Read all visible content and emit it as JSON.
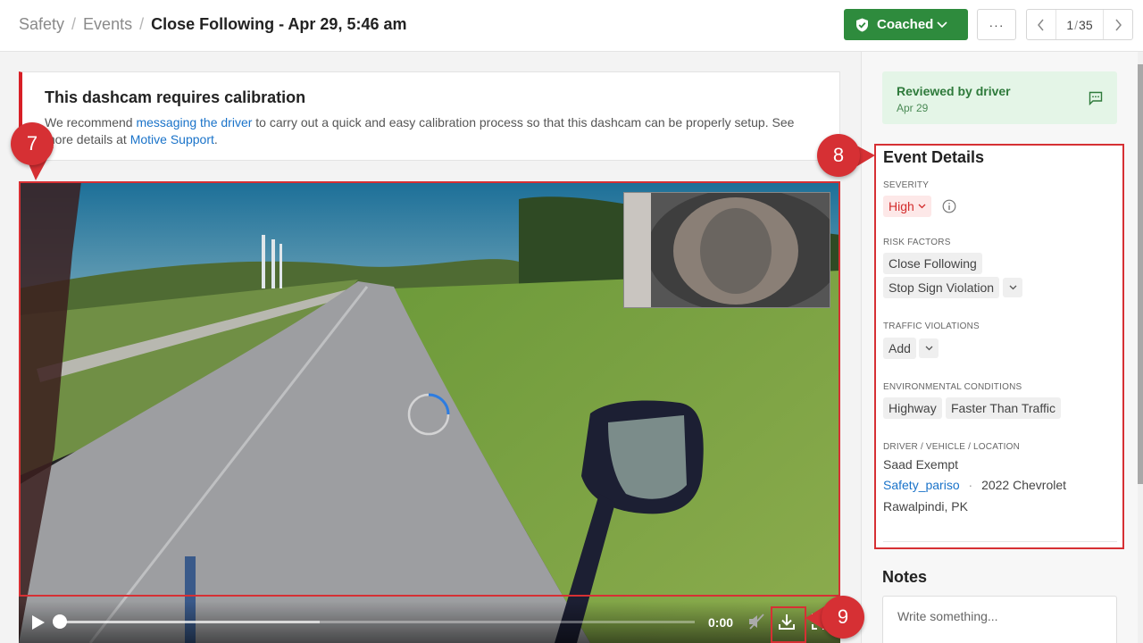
{
  "header": {
    "breadcrumb": [
      "Safety",
      "Events"
    ],
    "title": "Close Following - Apr 29, 5:46 am",
    "coached_label": "Coached",
    "more_label": "···",
    "pager": {
      "current": "1",
      "separator": "/",
      "total": "35"
    }
  },
  "banner": {
    "title": "This dashcam requires calibration",
    "text_before": "We recommend ",
    "link1": "messaging the driver",
    "text_middle": " to carry out a quick and easy calibration process so that this dashcam can be properly setup. See more details at ",
    "link2": "Motive Support",
    "text_after": "."
  },
  "video": {
    "time": "0:00",
    "progress_fraction": 0,
    "buffered_fraction": 0.41
  },
  "annotations": [
    "7",
    "8",
    "9"
  ],
  "sidebar": {
    "reviewed": {
      "title": "Reviewed by driver",
      "date": "Apr 29"
    },
    "details_title": "Event Details",
    "severity": {
      "label": "SEVERITY",
      "value": "High"
    },
    "risk_factors": {
      "label": "RISK FACTORS",
      "items": [
        "Close Following",
        "Stop Sign Violation"
      ]
    },
    "traffic_violations": {
      "label": "TRAFFIC VIOLATIONS",
      "add_label": "Add"
    },
    "environmental_conditions": {
      "label": "ENVIRONMENTAL CONDITIONS",
      "items": [
        "Highway",
        "Faster Than Traffic"
      ]
    },
    "driver_vehicle_location": {
      "label": "DRIVER / VEHICLE / LOCATION",
      "driver": "Saad Exempt",
      "vehicle_id": "Safety_pariso",
      "dot": "·",
      "vehicle": "2022 Chevrolet",
      "location": "Rawalpindi, PK"
    },
    "notes": {
      "title": "Notes",
      "placeholder": "Write something..."
    }
  },
  "colors": {
    "accent_green": "#2e8b3d",
    "link_blue": "#1a73c9",
    "alert_red": "#d81f26",
    "annotation_red": "#d63034",
    "severity_bg": "#fde8e8"
  }
}
